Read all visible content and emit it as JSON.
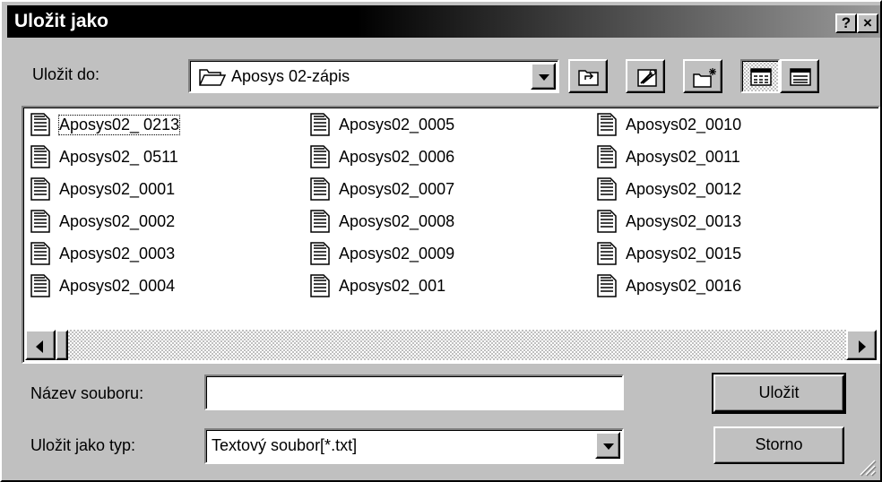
{
  "window": {
    "title": "Uložit jako",
    "help_label": "?",
    "close_label": "×"
  },
  "lookin": {
    "label": "Uložit do:",
    "value": "Aposys 02-zápis"
  },
  "files": [
    "Aposys02_ 0213",
    "Aposys02_ 0511",
    "Aposys02_0001",
    "Aposys02_0002",
    "Aposys02_0003",
    "Aposys02_0004",
    "Aposys02_0005",
    "Aposys02_0006",
    "Aposys02_0007",
    "Aposys02_0008",
    "Aposys02_0009",
    "Aposys02_001",
    "Aposys02_0010",
    "Aposys02_0011",
    "Aposys02_0012",
    "Aposys02_0013",
    "Aposys02_0015",
    "Aposys02_0016"
  ],
  "filename": {
    "label": "Název souboru:",
    "value": ""
  },
  "filetype": {
    "label": "Uložit jako typ:",
    "value": "Textový soubor[*.txt]"
  },
  "buttons": {
    "save": "Uložit",
    "cancel": "Storno"
  }
}
